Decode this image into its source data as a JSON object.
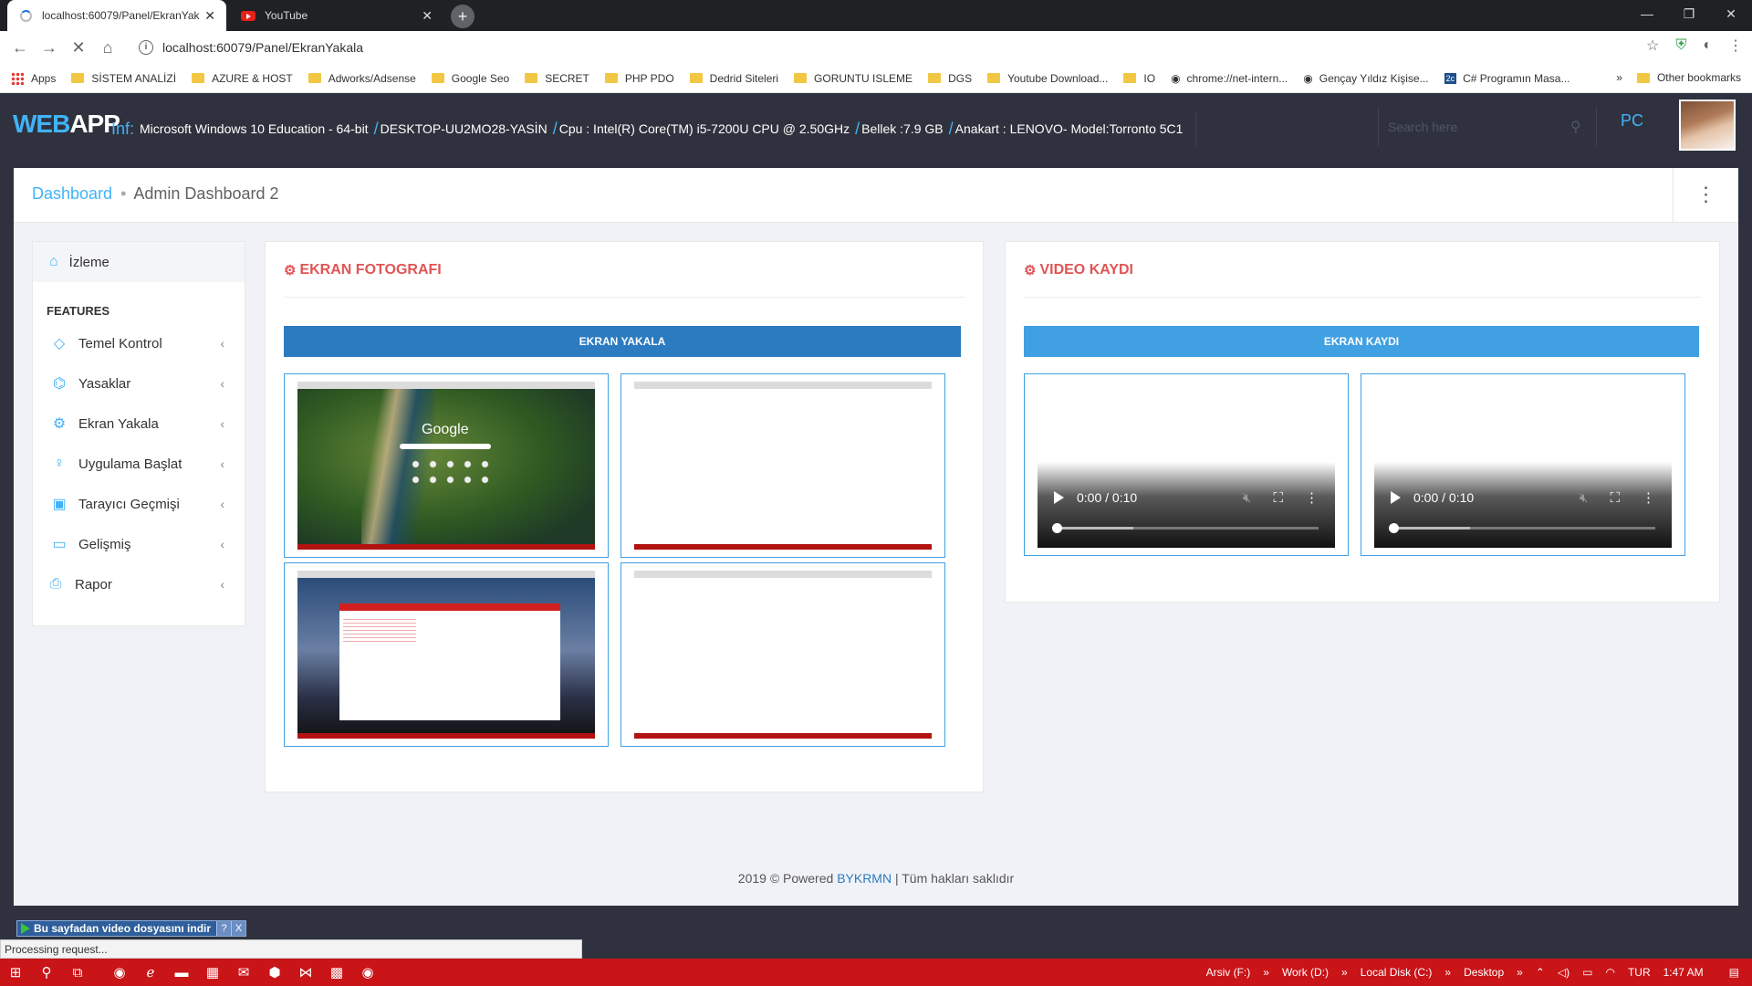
{
  "browser": {
    "tabs": [
      {
        "title": "localhost:60079/Panel/EkranYak",
        "active": true
      },
      {
        "title": "YouTube",
        "active": false
      }
    ],
    "url": "localhost:60079/Panel/EkranYakala",
    "bookmarks": [
      "Apps",
      "SİSTEM ANALİZİ",
      "AZURE & HOST",
      "Adworks/Adsense",
      "Google Seo",
      "SECRET",
      "PHP PDO",
      "Dedrid Siteleri",
      "GORUNTU ISLEME",
      "DGS",
      "Youtube Download...",
      "IO",
      "chrome://net-intern...",
      "Gençay Yıldız Kişise...",
      "C# Programın Masa..."
    ],
    "bookmarks_more": "»",
    "other_bookmarks": "Other bookmarks"
  },
  "header": {
    "logo_web": "WEB",
    "logo_app": "APP",
    "inf_label": "Inf:",
    "os": "Microsoft Windows 10 Education - 64-bit",
    "host": "DESKTOP-UU2MO28-YASİN",
    "cpu": "Cpu : Intel(R) Core(TM) i5-7200U CPU @ 2.50GHz",
    "ram": "Bellek :7.9 GB",
    "board": "Anakart : LENOVO- Model:Torronto 5C1",
    "search_placeholder": "Search here",
    "pc_label": "PC"
  },
  "breadcrumb": {
    "home": "Dashboard",
    "current": "Admin Dashboard 2"
  },
  "sidebar": {
    "top": "İzleme",
    "heading": "FEATURES",
    "items": [
      {
        "label": "Temel Kontrol",
        "icon": "diamond-icon"
      },
      {
        "label": "Yasaklar",
        "icon": "tag-icon"
      },
      {
        "label": "Ekran Yakala",
        "icon": "gear-icon"
      },
      {
        "label": "Uygulama Başlat",
        "icon": "bulb-icon"
      },
      {
        "label": "Tarayıcı Geçmişi",
        "icon": "briefcase-icon"
      },
      {
        "label": "Gelişmiş",
        "icon": "folder-icon"
      },
      {
        "label": "Rapor",
        "icon": "printer-icon"
      }
    ]
  },
  "screenshots": {
    "title": "EKRAN FOTOGRAFI",
    "button": "EKRAN YAKALA",
    "google_word": "Google"
  },
  "videos": {
    "title": "VIDEO KAYDI",
    "button": "EKRAN KAYDI",
    "items": [
      {
        "time": "0:00 / 0:10"
      },
      {
        "time": "0:00 / 0:10"
      }
    ]
  },
  "footer": {
    "prefix": "2019 © Powered",
    "brand": "BYKRMN",
    "suffix": "| Tüm hakları saklıdır"
  },
  "download_bar": {
    "label": "Bu sayfadan video dosyasını indir",
    "help": "?",
    "close": "X"
  },
  "status": "Processing request...",
  "taskbar": {
    "drives": [
      "Arsiv (F:)",
      "Work (D:)",
      "Local Disk (C:)",
      "Desktop"
    ],
    "lang": "TUR",
    "time": "1:47 AM"
  },
  "colors": {
    "accent": "#41b3f9",
    "title_red": "#e05555",
    "button_dark": "#2c7bc0",
    "button_light": "#41a0e2",
    "taskbar": "#c91418"
  }
}
